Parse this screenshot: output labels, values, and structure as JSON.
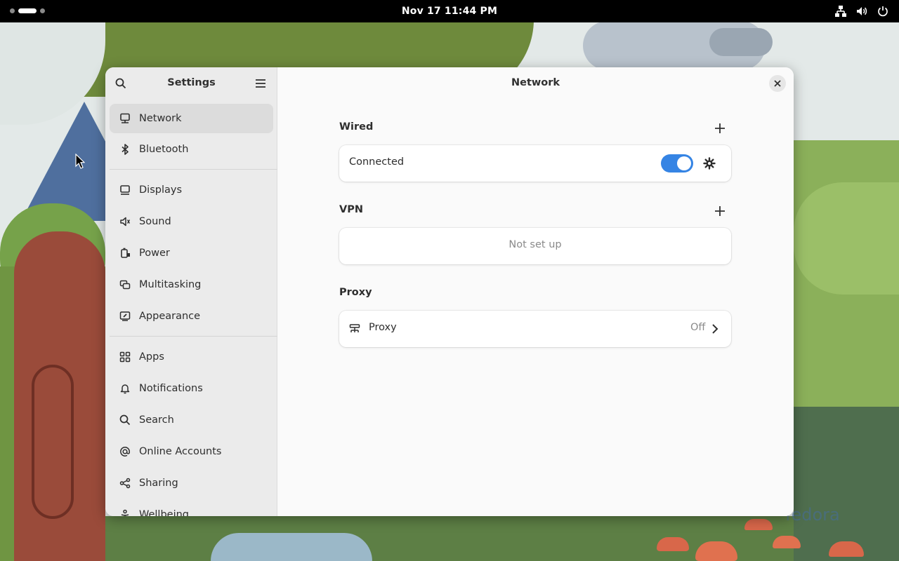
{
  "topbar": {
    "clock": "Nov 17  11:44 PM",
    "tray_icons": [
      "network-wired-icon",
      "volume-icon",
      "power-icon"
    ]
  },
  "window": {
    "sidebar": {
      "title": "Settings",
      "items": [
        {
          "label": "Network",
          "icon": "network-icon",
          "active": true
        },
        {
          "label": "Bluetooth",
          "icon": "bluetooth-icon"
        },
        {
          "label": "Displays",
          "icon": "display-icon"
        },
        {
          "label": "Sound",
          "icon": "speaker-icon"
        },
        {
          "label": "Power",
          "icon": "battery-icon"
        },
        {
          "label": "Multitasking",
          "icon": "multitasking-icon"
        },
        {
          "label": "Appearance",
          "icon": "appearance-icon"
        },
        {
          "label": "Apps",
          "icon": "apps-grid-icon"
        },
        {
          "label": "Notifications",
          "icon": "bell-icon"
        },
        {
          "label": "Search",
          "icon": "search-icon"
        },
        {
          "label": "Online Accounts",
          "icon": "at-icon"
        },
        {
          "label": "Sharing",
          "icon": "share-icon"
        },
        {
          "label": "Wellbeing",
          "icon": "wellbeing-icon"
        }
      ]
    },
    "content": {
      "title": "Network",
      "wired": {
        "heading": "Wired",
        "status": "Connected",
        "toggle_on": true
      },
      "vpn": {
        "heading": "VPN",
        "status": "Not set up"
      },
      "proxy": {
        "heading": "Proxy",
        "label": "Proxy",
        "value": "Off"
      }
    }
  },
  "wallpaper": {
    "watermark": "fedora"
  },
  "colors": {
    "accent": "#3584e4",
    "sidebar_bg": "#ebebeb",
    "content_bg": "#fafafa",
    "topbar_bg": "#000000"
  }
}
